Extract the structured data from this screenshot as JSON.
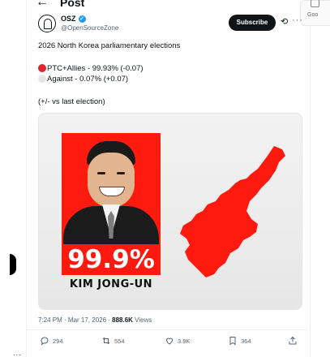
{
  "header": {
    "back_icon": "arrow-left-icon",
    "title": "Post"
  },
  "right_panel": {
    "label": "Goo"
  },
  "author": {
    "name": "OSZ",
    "verified": true,
    "handle": "@OpenSourceZone",
    "subscribe_label": "Subscribe"
  },
  "post": {
    "line1": "2026 North Korea parliamentary elections",
    "line2": "PTC+Allies - 99.93% (-0.07)",
    "line2_dot_color": "#e0242e",
    "line3": "Against - 0.07% (+0.07)",
    "line3_dot_color": "#e6e6e6",
    "line4": "(+/- vs last election)"
  },
  "media": {
    "percent": "99.9%",
    "name": "KIM JONG-UN",
    "accent": "#ff1a0f"
  },
  "meta": {
    "time": "7:24 PM · Mar 17, 2026 · ",
    "views_count": "888.6K",
    "views_label": " Views"
  },
  "actions": {
    "replies": "294",
    "reposts": "554",
    "likes": "3.9K",
    "bookmarks": "364"
  },
  "left_nav": {
    "more_label": "..."
  }
}
